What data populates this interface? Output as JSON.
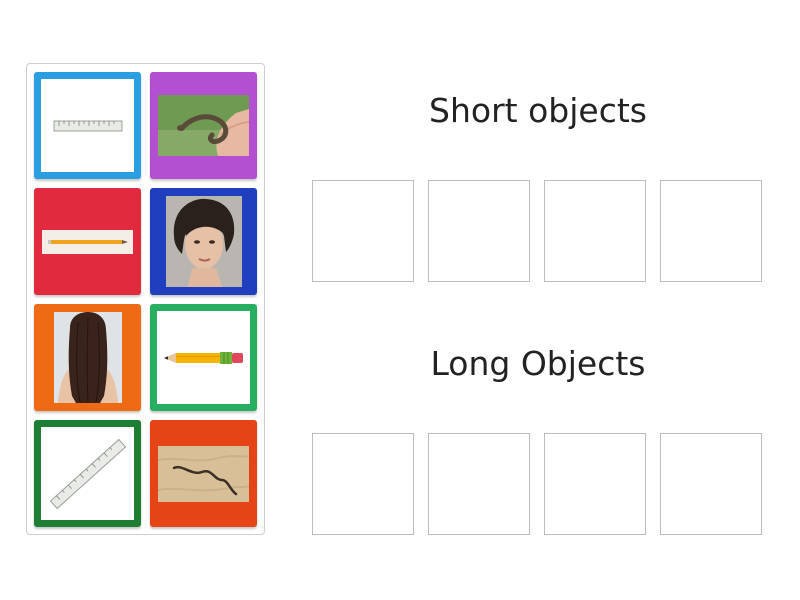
{
  "activity": {
    "groups": [
      {
        "title": "Short objects",
        "slot_count": 4
      },
      {
        "title": "Long Objects",
        "slot_count": 4
      }
    ],
    "cards": [
      {
        "icon": "short-ruler-image",
        "color": "#2a9ee0",
        "style": "framed"
      },
      {
        "icon": "short-snake-image",
        "color": "#b34fd1",
        "style": "filled"
      },
      {
        "icon": "long-pencil-image",
        "color": "#e12a3d",
        "style": "filled"
      },
      {
        "icon": "short-hair-woman-image",
        "color": "#1f3fbf",
        "style": "filled"
      },
      {
        "icon": "long-hair-image",
        "color": "#ef6a14",
        "style": "filled"
      },
      {
        "icon": "short-pencil-image",
        "color": "#27ae60",
        "style": "framed"
      },
      {
        "icon": "long-ruler-image",
        "color": "#1e7e34",
        "style": "framed"
      },
      {
        "icon": "long-snake-image",
        "color": "#e54416",
        "style": "filled"
      }
    ]
  }
}
